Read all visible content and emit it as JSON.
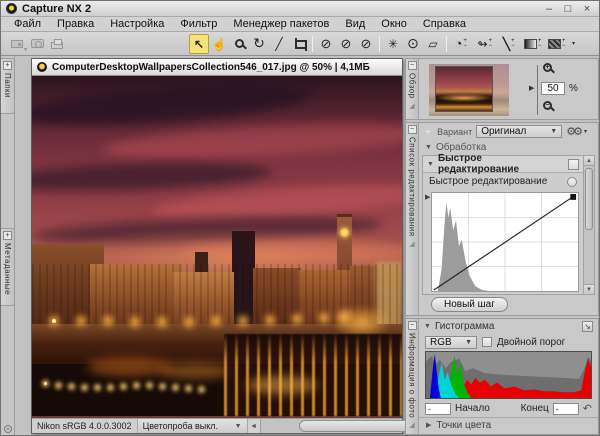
{
  "window": {
    "title": "Capture NX 2",
    "minimize": "–",
    "maximize": "□",
    "close": "×"
  },
  "menu": {
    "items": [
      "Файл",
      "Правка",
      "Настройка",
      "Фильтр",
      "Менеджер пакетов",
      "Вид",
      "Окно",
      "Справка"
    ]
  },
  "glyphs": {
    "tri_down": "▼",
    "tri_right": "▶",
    "caret": "▾",
    "plus": "+",
    "minus": "−",
    "collapse": "−",
    "expand": "+",
    "scroll_up": "▲",
    "scroll_down": "▼",
    "scroll_left": "◄",
    "marker_right": "▶",
    "burst": "✳",
    "gears": "⚙⚙",
    "corner_expand": "↘",
    "reset": "↶",
    "grip": "◢"
  },
  "toolbar": {
    "tools": [
      {
        "name": "transfer",
        "glyph": ""
      },
      {
        "name": "camera-settings",
        "glyph": ""
      },
      {
        "name": "print",
        "glyph": ""
      },
      {
        "name": "direct-select-tool",
        "glyph": "↖"
      },
      {
        "name": "hand-tool",
        "glyph": "☝"
      },
      {
        "name": "zoom-tool",
        "glyph": ""
      },
      {
        "name": "rotate-tool",
        "glyph": "↻"
      },
      {
        "name": "straighten-tool",
        "glyph": "╱"
      },
      {
        "name": "crop-tool",
        "glyph": ""
      },
      {
        "name": "black-control-point",
        "glyph": "⊘"
      },
      {
        "name": "neutral-control-point",
        "glyph": "⊘"
      },
      {
        "name": "white-control-point",
        "glyph": "⊘"
      },
      {
        "name": "auto-retouch-brush",
        "glyph": "✳"
      },
      {
        "name": "red-eye-control-point",
        "glyph": "⊙"
      },
      {
        "name": "eraser-tool",
        "glyph": "▱"
      },
      {
        "name": "color-control-point",
        "glyph": "◔"
      },
      {
        "name": "selection-control-point",
        "glyph": "↬"
      },
      {
        "name": "selection-brush",
        "glyph": "╲"
      },
      {
        "name": "selection-gradient",
        "glyph": ""
      },
      {
        "name": "selection-fill",
        "glyph": ""
      }
    ]
  },
  "left_tabs": {
    "folders": "Папки",
    "metadata": "Метаданные"
  },
  "image_window": {
    "title": "ComputerDesktopWallpapersCollection546_017.jpg  @  50%  |  4,1МБ",
    "status_profile": "Nikon sRGB 4.0.0.3002",
    "status_proof": "Цветопроба выкл."
  },
  "navigator": {
    "tab": "Обзор",
    "zoom_value": "50",
    "percent": "%"
  },
  "edit_list": {
    "tab": "Список редактирования",
    "variant_label": "Вариант",
    "variant_value": "Оригинал",
    "processing": "Обработка",
    "quick_fix": "Быстрое редактирование",
    "quick_fix_sub": "Быстрое редактирование",
    "new_step": "Новый шаг"
  },
  "histogram_panel": {
    "tab": "Информация о фото",
    "title": "Гистограмма",
    "channel": "RGB",
    "dual_threshold": "Двойной порог",
    "start_label": "Начало",
    "start_value": "-",
    "end_label": "Конец",
    "end_value": "-",
    "color_points": "Точки цвета"
  }
}
